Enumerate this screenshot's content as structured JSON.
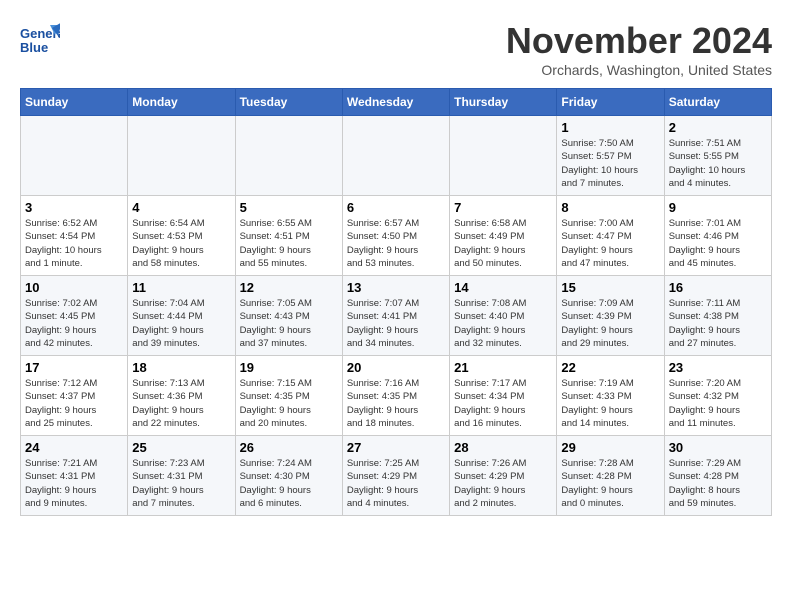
{
  "logo": {
    "line1": "General",
    "line2": "Blue"
  },
  "title": "November 2024",
  "subtitle": "Orchards, Washington, United States",
  "weekdays": [
    "Sunday",
    "Monday",
    "Tuesday",
    "Wednesday",
    "Thursday",
    "Friday",
    "Saturday"
  ],
  "weeks": [
    [
      {
        "day": "",
        "info": ""
      },
      {
        "day": "",
        "info": ""
      },
      {
        "day": "",
        "info": ""
      },
      {
        "day": "",
        "info": ""
      },
      {
        "day": "",
        "info": ""
      },
      {
        "day": "1",
        "info": "Sunrise: 7:50 AM\nSunset: 5:57 PM\nDaylight: 10 hours\nand 7 minutes."
      },
      {
        "day": "2",
        "info": "Sunrise: 7:51 AM\nSunset: 5:55 PM\nDaylight: 10 hours\nand 4 minutes."
      }
    ],
    [
      {
        "day": "3",
        "info": "Sunrise: 6:52 AM\nSunset: 4:54 PM\nDaylight: 10 hours\nand 1 minute."
      },
      {
        "day": "4",
        "info": "Sunrise: 6:54 AM\nSunset: 4:53 PM\nDaylight: 9 hours\nand 58 minutes."
      },
      {
        "day": "5",
        "info": "Sunrise: 6:55 AM\nSunset: 4:51 PM\nDaylight: 9 hours\nand 55 minutes."
      },
      {
        "day": "6",
        "info": "Sunrise: 6:57 AM\nSunset: 4:50 PM\nDaylight: 9 hours\nand 53 minutes."
      },
      {
        "day": "7",
        "info": "Sunrise: 6:58 AM\nSunset: 4:49 PM\nDaylight: 9 hours\nand 50 minutes."
      },
      {
        "day": "8",
        "info": "Sunrise: 7:00 AM\nSunset: 4:47 PM\nDaylight: 9 hours\nand 47 minutes."
      },
      {
        "day": "9",
        "info": "Sunrise: 7:01 AM\nSunset: 4:46 PM\nDaylight: 9 hours\nand 45 minutes."
      }
    ],
    [
      {
        "day": "10",
        "info": "Sunrise: 7:02 AM\nSunset: 4:45 PM\nDaylight: 9 hours\nand 42 minutes."
      },
      {
        "day": "11",
        "info": "Sunrise: 7:04 AM\nSunset: 4:44 PM\nDaylight: 9 hours\nand 39 minutes."
      },
      {
        "day": "12",
        "info": "Sunrise: 7:05 AM\nSunset: 4:43 PM\nDaylight: 9 hours\nand 37 minutes."
      },
      {
        "day": "13",
        "info": "Sunrise: 7:07 AM\nSunset: 4:41 PM\nDaylight: 9 hours\nand 34 minutes."
      },
      {
        "day": "14",
        "info": "Sunrise: 7:08 AM\nSunset: 4:40 PM\nDaylight: 9 hours\nand 32 minutes."
      },
      {
        "day": "15",
        "info": "Sunrise: 7:09 AM\nSunset: 4:39 PM\nDaylight: 9 hours\nand 29 minutes."
      },
      {
        "day": "16",
        "info": "Sunrise: 7:11 AM\nSunset: 4:38 PM\nDaylight: 9 hours\nand 27 minutes."
      }
    ],
    [
      {
        "day": "17",
        "info": "Sunrise: 7:12 AM\nSunset: 4:37 PM\nDaylight: 9 hours\nand 25 minutes."
      },
      {
        "day": "18",
        "info": "Sunrise: 7:13 AM\nSunset: 4:36 PM\nDaylight: 9 hours\nand 22 minutes."
      },
      {
        "day": "19",
        "info": "Sunrise: 7:15 AM\nSunset: 4:35 PM\nDaylight: 9 hours\nand 20 minutes."
      },
      {
        "day": "20",
        "info": "Sunrise: 7:16 AM\nSunset: 4:35 PM\nDaylight: 9 hours\nand 18 minutes."
      },
      {
        "day": "21",
        "info": "Sunrise: 7:17 AM\nSunset: 4:34 PM\nDaylight: 9 hours\nand 16 minutes."
      },
      {
        "day": "22",
        "info": "Sunrise: 7:19 AM\nSunset: 4:33 PM\nDaylight: 9 hours\nand 14 minutes."
      },
      {
        "day": "23",
        "info": "Sunrise: 7:20 AM\nSunset: 4:32 PM\nDaylight: 9 hours\nand 11 minutes."
      }
    ],
    [
      {
        "day": "24",
        "info": "Sunrise: 7:21 AM\nSunset: 4:31 PM\nDaylight: 9 hours\nand 9 minutes."
      },
      {
        "day": "25",
        "info": "Sunrise: 7:23 AM\nSunset: 4:31 PM\nDaylight: 9 hours\nand 7 minutes."
      },
      {
        "day": "26",
        "info": "Sunrise: 7:24 AM\nSunset: 4:30 PM\nDaylight: 9 hours\nand 6 minutes."
      },
      {
        "day": "27",
        "info": "Sunrise: 7:25 AM\nSunset: 4:29 PM\nDaylight: 9 hours\nand 4 minutes."
      },
      {
        "day": "28",
        "info": "Sunrise: 7:26 AM\nSunset: 4:29 PM\nDaylight: 9 hours\nand 2 minutes."
      },
      {
        "day": "29",
        "info": "Sunrise: 7:28 AM\nSunset: 4:28 PM\nDaylight: 9 hours\nand 0 minutes."
      },
      {
        "day": "30",
        "info": "Sunrise: 7:29 AM\nSunset: 4:28 PM\nDaylight: 8 hours\nand 59 minutes."
      }
    ]
  ]
}
